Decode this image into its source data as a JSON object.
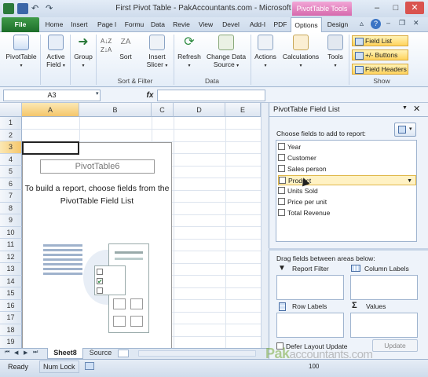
{
  "window": {
    "title": "First Pivot Table - PakAccountants.com - Microsoft Excel",
    "context_tab": "PivotTable Tools"
  },
  "tabs": [
    "File",
    "Home",
    "Insert",
    "Page l",
    "Formu",
    "Data",
    "Revie",
    "View",
    "Devel",
    "Add-I",
    "PDF",
    "Options",
    "Design"
  ],
  "ribbon": {
    "buttons": {
      "pivottable": "PivotTable",
      "active_field": "Active Field",
      "group": "Group",
      "sort": "Sort",
      "insert_slicer": "Insert Slicer",
      "refresh": "Refresh",
      "change_data_source": "Change Data Source",
      "actions": "Actions",
      "calculations": "Calculations",
      "tools": "Tools",
      "field_list": "Field List",
      "plus_minus_buttons": "+/- Buttons",
      "field_headers": "Field Headers"
    },
    "groups": {
      "sort_filter": "Sort & Filter",
      "data": "Data",
      "show": "Show"
    }
  },
  "formula_bar": {
    "name_box": "A3",
    "fx": "fx",
    "value": ""
  },
  "grid": {
    "columns": [
      "A",
      "B",
      "C",
      "D",
      "E"
    ],
    "rows": [
      "1",
      "2",
      "3",
      "4",
      "5",
      "6",
      "7",
      "8",
      "9",
      "10",
      "11",
      "12",
      "13",
      "14",
      "15",
      "16",
      "17",
      "18",
      "19"
    ]
  },
  "pivot_placeholder": {
    "name": "PivotTable6",
    "message": "To build a report, choose fields from the PivotTable Field List"
  },
  "sheet_tabs": [
    "Sheet8",
    "Source"
  ],
  "status_bar": {
    "ready": "Ready",
    "num_lock": "Num Lock",
    "zoom": "100"
  },
  "field_list": {
    "title": "PivotTable Field List",
    "choose_label": "Choose fields to add to report:",
    "fields": [
      "Year",
      "Customer",
      "Sales person",
      "Product",
      "Units Sold",
      "Price per unit",
      "Total Revenue"
    ],
    "drag_label": "Drag fields between areas below:",
    "areas": {
      "report_filter": "Report Filter",
      "column_labels": "Column Labels",
      "row_labels": "Row Labels",
      "values": "Values"
    },
    "defer_label": "Defer Layout Update",
    "update_label": "Update"
  },
  "watermark": {
    "brand": "Pak",
    "rest": "accountants.com"
  },
  "colors": {
    "file_tab": "#1d6e2a",
    "context_tab": "#d66aad",
    "show_button": "#ffd35c",
    "ribbon_border": "#9fb4cf"
  }
}
